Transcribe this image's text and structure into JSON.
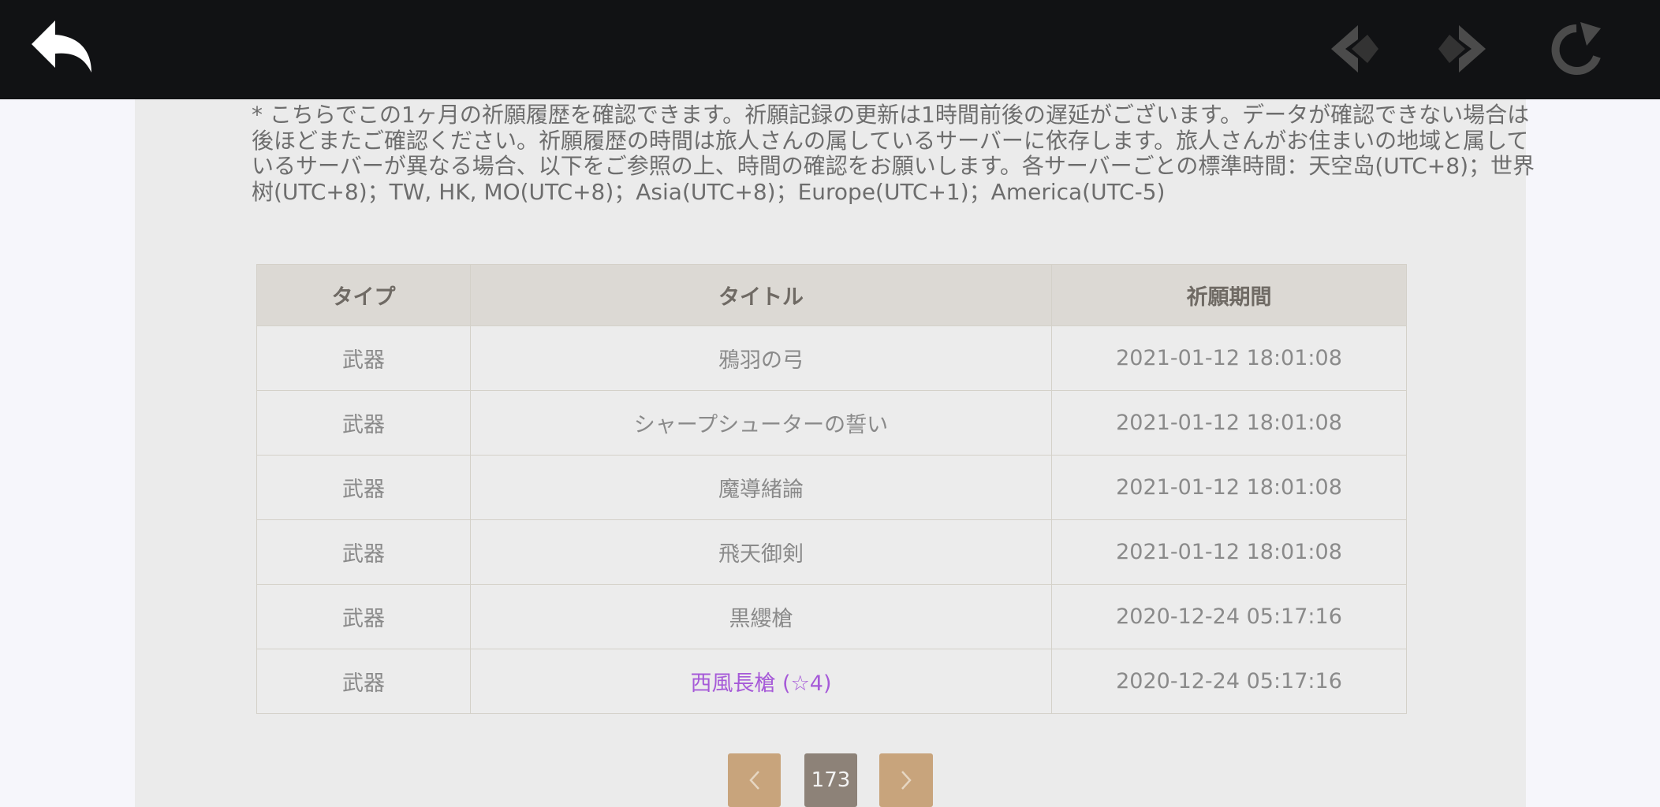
{
  "topbar": {
    "back_icon": "back-arrow-icon",
    "prev_icon": "prev-diamond-icon",
    "next_icon": "next-diamond-icon",
    "reload_icon": "reload-icon"
  },
  "notice": "* こちらでこの1ヶ月の祈願履歴を確認できます。祈願記録の更新は1時間前後の遅延がございます。データが確認できない場合は後ほどまたご確認ください。祈願履歴の時間は旅人さんの属しているサーバーに依存します。旅人さんがお住まいの地域と属しているサーバーが異なる場合、以下をご参照の上、時間の確認をお願いします。各サーバーごとの標準時間：天空岛(UTC+8)；世界树(UTC+8)；TW, HK, MO(UTC+8)；Asia(UTC+8)；Europe(UTC+1)；America(UTC-5)",
  "table": {
    "headers": [
      "タイプ",
      "タイトル",
      "祈願期間"
    ],
    "rows": [
      {
        "type": "武器",
        "title": "鴉羽の弓",
        "time": "2021-01-12 18:01:08"
      },
      {
        "type": "武器",
        "title": "シャープシューターの誓い",
        "time": "2021-01-12 18:01:08"
      },
      {
        "type": "武器",
        "title": "魔導緒論",
        "time": "2021-01-12 18:01:08"
      },
      {
        "type": "武器",
        "title": "飛天御剣",
        "time": "2021-01-12 18:01:08"
      },
      {
        "type": "武器",
        "title": "黒纓槍",
        "time": "2020-12-24 05:17:16"
      },
      {
        "type": "武器",
        "title": "西風長槍 (☆4)",
        "time": "2020-12-24 05:17:16"
      }
    ]
  },
  "pagination": {
    "current_page": "173",
    "prev_icon": "chevron-left-icon",
    "next_icon": "chevron-right-icon"
  },
  "colors": {
    "topbar": "#111214",
    "panel": "#ebebeb",
    "header_bg": "#dcd9d4",
    "rarity4_text": "#a65ad8",
    "pager_button": "#c8a47c",
    "pager_current": "#8d8278"
  }
}
